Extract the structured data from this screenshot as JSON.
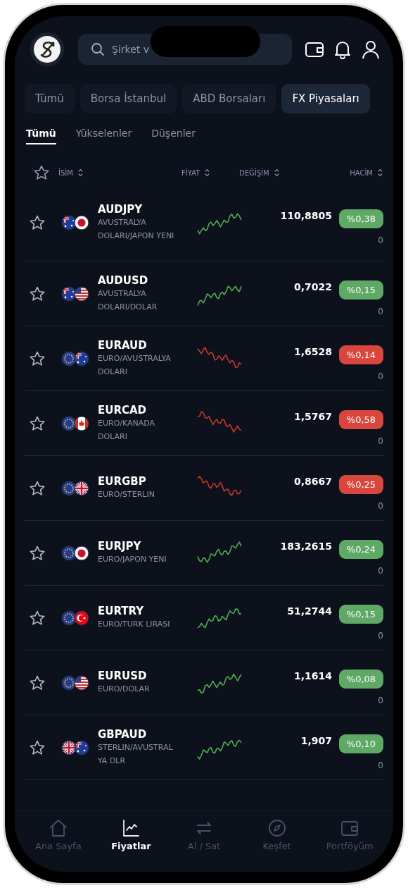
{
  "search": {
    "placeholder": "Şirket v"
  },
  "market_tabs": [
    {
      "label": "Tümü",
      "selected": false
    },
    {
      "label": "Borsa İstanbul",
      "selected": false
    },
    {
      "label": "ABD Borsaları",
      "selected": false
    },
    {
      "label": "FX Piyasaları",
      "selected": true
    }
  ],
  "filter_tabs": [
    {
      "label": "Tümü",
      "selected": true
    },
    {
      "label": "Yükselenler",
      "selected": false
    },
    {
      "label": "Düşenler",
      "selected": false
    }
  ],
  "columns": [
    "İSİM",
    "FİYAT",
    "DEĞİŞİM",
    "HACİM"
  ],
  "rows": [
    {
      "symbol": "AUDJPY",
      "description": "AVUSTRALYA DOLARI/JAPON YENI",
      "price": "110,8805",
      "change": "%0,38",
      "volume": "0",
      "kind": "up",
      "favorite": false,
      "flags": [
        {
          "kind": "au"
        },
        {
          "kind": "jp"
        }
      ]
    },
    {
      "symbol": "AUDUSD",
      "description": "AVUSTRALYA DOLARI/DOLAR",
      "price": "0,7022",
      "change": "%0,15",
      "volume": "0",
      "kind": "up",
      "favorite": false,
      "flags": [
        {
          "kind": "au"
        },
        {
          "kind": "us"
        }
      ]
    },
    {
      "symbol": "EURAUD",
      "description": "EURO/AVUSTRALYA DOLARI",
      "price": "1,6528",
      "change": "%0,14",
      "volume": "0",
      "kind": "down",
      "favorite": false,
      "flags": [
        {
          "kind": "eu"
        },
        {
          "kind": "au"
        }
      ]
    },
    {
      "symbol": "EURCAD",
      "description": "EURO/KANADA DOLARI",
      "price": "1,5767",
      "change": "%0,58",
      "volume": "0",
      "kind": "down",
      "favorite": false,
      "flags": [
        {
          "kind": "eu"
        },
        {
          "kind": "ca"
        }
      ]
    },
    {
      "symbol": "EURGBP",
      "description": "EURO/STERLIN",
      "price": "0,8667",
      "change": "%0,25",
      "volume": "0",
      "kind": "down",
      "favorite": false,
      "flags": [
        {
          "kind": "eu"
        },
        {
          "kind": "gb"
        }
      ]
    },
    {
      "symbol": "EURJPY",
      "description": "EURO/JAPON YENI",
      "price": "183,2615",
      "change": "%0,24",
      "volume": "0",
      "kind": "up",
      "favorite": false,
      "flags": [
        {
          "kind": "eu"
        },
        {
          "kind": "jp"
        }
      ]
    },
    {
      "symbol": "EURTRY",
      "description": "EURO/TURK LIRASI",
      "price": "51,2744",
      "change": "%0,15",
      "volume": "0",
      "kind": "up",
      "favorite": false,
      "flags": [
        {
          "kind": "eu"
        },
        {
          "kind": "tr"
        }
      ]
    },
    {
      "symbol": "EURUSD",
      "description": "EURO/DOLAR",
      "price": "1,1614",
      "change": "%0,08",
      "volume": "0",
      "kind": "up",
      "favorite": false,
      "flags": [
        {
          "kind": "eu"
        },
        {
          "kind": "us"
        }
      ]
    },
    {
      "symbol": "GBPAUD",
      "description": "STERLIN/AVUSTRAL YA DLR",
      "price": "1,907",
      "change": "%0,10",
      "volume": "0",
      "kind": "up",
      "favorite": false,
      "flags": [
        {
          "kind": "gb"
        },
        {
          "kind": "au"
        }
      ]
    }
  ],
  "bottom_nav": [
    {
      "label": "Ana Sayfa",
      "kind": "home",
      "selected": false
    },
    {
      "label": "Fiyatlar",
      "kind": "chart",
      "selected": true
    },
    {
      "label": "Al / Sat",
      "kind": "swap",
      "selected": false
    },
    {
      "label": "Keşfet",
      "kind": "compass",
      "selected": false
    },
    {
      "label": "Portföyüm",
      "kind": "wallet",
      "selected": false
    }
  ]
}
